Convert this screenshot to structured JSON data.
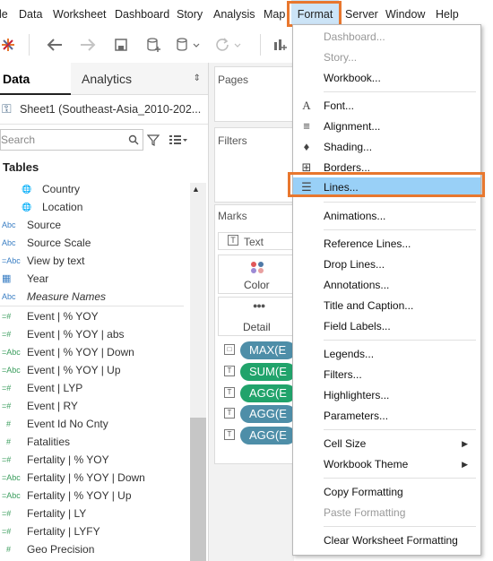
{
  "menubar": {
    "items": [
      {
        "label": "le"
      },
      {
        "label": "Data"
      },
      {
        "label": "Worksheet"
      },
      {
        "label": "Dashboard"
      },
      {
        "label": "Story"
      },
      {
        "label": "Analysis"
      },
      {
        "label": "Map"
      },
      {
        "label": "Format"
      },
      {
        "label": "Server"
      },
      {
        "label": "Window"
      },
      {
        "label": "Help"
      }
    ]
  },
  "left_panel": {
    "tabs": [
      {
        "label": "Data"
      },
      {
        "label": "Analytics"
      }
    ],
    "datasource": "Sheet1 (Southeast-Asia_2010-202...",
    "search_placeholder": "Search",
    "tables_header": "Tables",
    "fields": [
      {
        "label": "Country",
        "icon": "globe"
      },
      {
        "label": "Location",
        "icon": "globe"
      },
      {
        "label": "Source",
        "icon": "Abc"
      },
      {
        "label": "Source Scale",
        "icon": "Abc"
      },
      {
        "label": "View by text",
        "icon": "=Abc"
      },
      {
        "label": "Year",
        "icon": "calendar"
      },
      {
        "label": "Measure Names",
        "icon": "Abc"
      },
      {
        "label": "Event | % YOY",
        "icon": "=#"
      },
      {
        "label": "Event | % YOY | abs",
        "icon": "=#"
      },
      {
        "label": "Event | % YOY | Down",
        "icon": "=Abc"
      },
      {
        "label": "Event | % YOY | Up",
        "icon": "=Abc"
      },
      {
        "label": "Event | LYP",
        "icon": "=#"
      },
      {
        "label": "Event | RY",
        "icon": "=#"
      },
      {
        "label": "Event Id No Cnty",
        "icon": "#"
      },
      {
        "label": "Fatalities",
        "icon": "#"
      },
      {
        "label": "Fertality | % YOY",
        "icon": "=#"
      },
      {
        "label": "Fertality | % YOY | Down",
        "icon": "=Abc"
      },
      {
        "label": "Fertality | % YOY | Up",
        "icon": "=Abc"
      },
      {
        "label": "Fertality | LY",
        "icon": "=#"
      },
      {
        "label": "Fertality | LYFY",
        "icon": "=#"
      },
      {
        "label": "Geo Precision",
        "icon": "#"
      }
    ]
  },
  "middle_panel": {
    "pages": "Pages",
    "filters": "Filters",
    "marks": "Marks",
    "mark_type": "Text",
    "color": "Color",
    "detail": "Detail",
    "pills": [
      "MAX(E",
      "SUM(E",
      "AGG(E",
      "AGG(E",
      "AGG(E"
    ]
  },
  "format_menu": {
    "items": [
      {
        "label": "Dashboard...",
        "disabled": true
      },
      {
        "label": "Story...",
        "disabled": true
      },
      {
        "label": "Workbook...",
        "disabled": false
      },
      {
        "label": "Font...",
        "disabled": false
      },
      {
        "label": "Alignment...",
        "disabled": false
      },
      {
        "label": "Shading...",
        "disabled": false
      },
      {
        "label": "Borders...",
        "disabled": false
      },
      {
        "label": "Lines...",
        "disabled": false,
        "hover": true
      },
      {
        "label": "Animations...",
        "disabled": false
      },
      {
        "label": "Reference Lines...",
        "disabled": false
      },
      {
        "label": "Drop Lines...",
        "disabled": false
      },
      {
        "label": "Annotations...",
        "disabled": false
      },
      {
        "label": "Title and Caption...",
        "disabled": false
      },
      {
        "label": "Field Labels...",
        "disabled": false
      },
      {
        "label": "Legends...",
        "disabled": false
      },
      {
        "label": "Filters...",
        "disabled": false
      },
      {
        "label": "Highlighters...",
        "disabled": false
      },
      {
        "label": "Parameters...",
        "disabled": false
      },
      {
        "label": "Cell Size",
        "disabled": false,
        "submenu": true
      },
      {
        "label": "Workbook Theme",
        "disabled": false,
        "submenu": true
      },
      {
        "label": "Copy Formatting",
        "disabled": false
      },
      {
        "label": "Paste Formatting",
        "disabled": true
      },
      {
        "label": "Clear Worksheet Formatting",
        "disabled": false
      }
    ]
  },
  "colors": {
    "highlight_border": "#e8772e",
    "menu_hover": "#99d0f7",
    "pill_blue": "#4e8ea8",
    "pill_green": "#21a36b"
  }
}
